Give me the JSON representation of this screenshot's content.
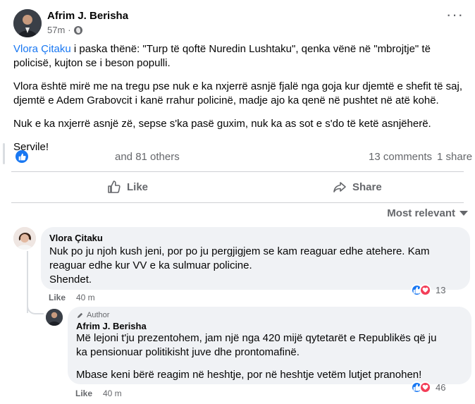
{
  "post": {
    "author": "Afrim J. Berisha",
    "time": "57m",
    "mention": "Vlora Çitaku",
    "p1_rest": " i paska thënë: \"Turp të qoftë Nuredin Lushtaku\", qenka vënë në \"mbrojtje\" të policisë, kujton se i beson populli.",
    "p2": "Vlora është mirë me na tregu pse nuk e ka nxjerrë asnjë fjalë nga goja kur djemtë e shefit të saj, djemtë e Adem Grabovcit i kanë rrahur policinë, madje ajo ka qenë në pushtet në atë kohë.",
    "p3": "Nuk e ka nxjerrë asnjë zë, sepse s'ka pasë guxim, nuk ka as sot e s'do të ketë asnjëherë.",
    "p4": "Servile!"
  },
  "stats": {
    "reactions_text": "and 81 others",
    "comments": "13 comments",
    "shares": "1 share"
  },
  "actions": {
    "like": "Like",
    "share": "Share"
  },
  "sort": {
    "label": "Most relevant"
  },
  "comments": [
    {
      "name": "Vlora Çitaku",
      "lines": [
        "Nuk po ju njoh kush jeni, por po ju pergjigjem se kam reaguar edhe atehere. Kam",
        "reaguar edhe kur VV e ka sulmuar policine.",
        "Shendet."
      ],
      "like": "Like",
      "time": "40 m",
      "reactions": "13"
    },
    {
      "badge": "Author",
      "name": "Afrim J. Berisha",
      "lines": [
        "Më lejoni t'ju prezentohem, jam një nga 420 mijë qytetarët e Republikës që ju",
        "ka pensionuar politikisht juve dhe prontomafinë."
      ],
      "line3": "Mbase keni bërë reagim në heshtje, por në heshtje vetëm lutjet pranohen!",
      "like": "Like",
      "time": "40 m",
      "reactions": "46"
    }
  ],
  "colors": {
    "accent": "#1877f2",
    "secondary_text": "#65676b",
    "bubble_bg": "#f0f2f5",
    "heart": "#f33e58"
  },
  "icons": [
    "globe-icon",
    "more-icon",
    "like-icon",
    "share-icon",
    "caret-down-icon",
    "heart-icon",
    "pen-icon"
  ]
}
